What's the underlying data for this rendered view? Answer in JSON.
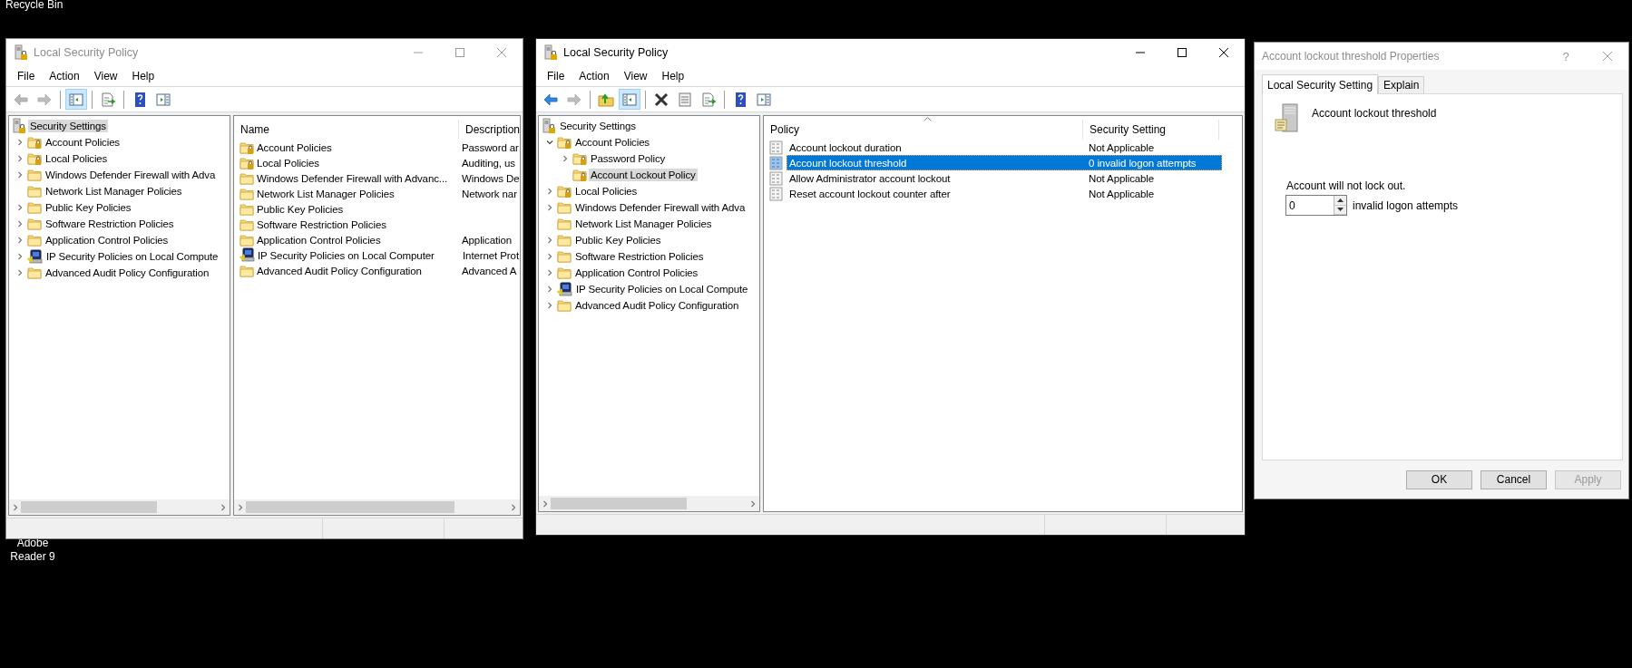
{
  "desktop": {
    "icons": [
      {
        "label": "Recycle Bin"
      },
      {
        "label": "Adobe Reader 9"
      }
    ]
  },
  "windows": [
    {
      "title": "Local Security Policy",
      "active": false,
      "menu": [
        "File",
        "Action",
        "View",
        "Help"
      ],
      "toolbar": [
        {
          "kind": "back",
          "enabled": false,
          "pressed": false
        },
        {
          "kind": "forward",
          "enabled": false,
          "pressed": false
        },
        {
          "kind": "separator"
        },
        {
          "kind": "tree-toggle",
          "enabled": true,
          "pressed": true
        },
        {
          "kind": "separator"
        },
        {
          "kind": "export",
          "enabled": true,
          "pressed": false
        },
        {
          "kind": "separator"
        },
        {
          "kind": "help",
          "enabled": true,
          "pressed": false
        },
        {
          "kind": "action-pane",
          "enabled": true,
          "pressed": false
        }
      ],
      "tree": [
        {
          "label": "Security Settings",
          "kind": "root",
          "selected": true,
          "children": [
            {
              "label": "Account Policies",
              "kind": "folder-lock",
              "expandable": true,
              "expanded": false,
              "selected": false
            },
            {
              "label": "Local Policies",
              "kind": "folder-lock",
              "expandable": true,
              "expanded": false,
              "selected": false
            },
            {
              "label": "Windows Defender Firewall with Adva",
              "kind": "folder",
              "expandable": true,
              "expanded": false,
              "selected": false
            },
            {
              "label": "Network List Manager Policies",
              "kind": "folder",
              "expandable": false,
              "expanded": false,
              "selected": false
            },
            {
              "label": "Public Key Policies",
              "kind": "folder",
              "expandable": true,
              "expanded": false,
              "selected": false
            },
            {
              "label": "Software Restriction Policies",
              "kind": "folder",
              "expandable": true,
              "expanded": false,
              "selected": false
            },
            {
              "label": "Application Control Policies",
              "kind": "folder",
              "expandable": true,
              "expanded": false,
              "selected": false
            },
            {
              "label": "IP Security Policies on Local Compute",
              "kind": "ipsec",
              "expandable": true,
              "expanded": false,
              "selected": false
            },
            {
              "label": "Advanced Audit Policy Configuration",
              "kind": "folder",
              "expandable": true,
              "expanded": false,
              "selected": false
            }
          ]
        }
      ],
      "list": {
        "columns": [
          {
            "label": "Name",
            "sorted": false
          },
          {
            "label": "Description",
            "sorted": false
          }
        ],
        "rows": [
          {
            "kind": "folder-lock",
            "cells": [
              "Account Policies",
              "Password ar"
            ],
            "selected": false
          },
          {
            "kind": "folder-lock",
            "cells": [
              "Local Policies",
              "Auditing, us"
            ],
            "selected": false
          },
          {
            "kind": "folder",
            "cells": [
              "Windows Defender Firewall with Advanc...",
              "Windows De"
            ],
            "selected": false
          },
          {
            "kind": "folder",
            "cells": [
              "Network List Manager Policies",
              "Network nar"
            ],
            "selected": false
          },
          {
            "kind": "folder",
            "cells": [
              "Public Key Policies"
            ],
            "selected": false
          },
          {
            "kind": "folder",
            "cells": [
              "Software Restriction Policies"
            ],
            "selected": false
          },
          {
            "kind": "folder",
            "cells": [
              "Application Control Policies",
              "Application"
            ],
            "selected": false
          },
          {
            "kind": "ipsec",
            "cells": [
              "IP Security Policies on Local Computer",
              "Internet Prot"
            ],
            "selected": false
          },
          {
            "kind": "folder",
            "cells": [
              "Advanced Audit Policy Configuration",
              "Advanced A"
            ],
            "selected": false
          }
        ]
      }
    },
    {
      "title": "Local Security Policy",
      "active": true,
      "menu": [
        "File",
        "Action",
        "View",
        "Help"
      ],
      "toolbar": [
        {
          "kind": "back",
          "enabled": true,
          "pressed": false
        },
        {
          "kind": "forward",
          "enabled": false,
          "pressed": false
        },
        {
          "kind": "separator"
        },
        {
          "kind": "up",
          "enabled": true,
          "pressed": false
        },
        {
          "kind": "tree-toggle",
          "enabled": true,
          "pressed": true
        },
        {
          "kind": "separator"
        },
        {
          "kind": "delete",
          "enabled": true,
          "pressed": false
        },
        {
          "kind": "properties",
          "enabled": true,
          "pressed": false
        },
        {
          "kind": "export",
          "enabled": true,
          "pressed": false
        },
        {
          "kind": "separator"
        },
        {
          "kind": "help",
          "enabled": true,
          "pressed": false
        },
        {
          "kind": "action-pane",
          "enabled": true,
          "pressed": false
        }
      ],
      "tree": [
        {
          "label": "Security Settings",
          "kind": "root",
          "selected": false,
          "children": [
            {
              "label": "Account Policies",
              "kind": "folder-lock",
              "expandable": true,
              "expanded": true,
              "selected": false,
              "children": [
                {
                  "label": "Password Policy",
                  "kind": "folder-lock",
                  "expandable": true,
                  "expanded": false,
                  "selected": false
                },
                {
                  "label": "Account Lockout Policy",
                  "kind": "folder-lock",
                  "expandable": false,
                  "expanded": false,
                  "selected": true
                }
              ]
            },
            {
              "label": "Local Policies",
              "kind": "folder-lock",
              "expandable": true,
              "expanded": false,
              "selected": false
            },
            {
              "label": "Windows Defender Firewall with Adva",
              "kind": "folder",
              "expandable": true,
              "expanded": false,
              "selected": false
            },
            {
              "label": "Network List Manager Policies",
              "kind": "folder",
              "expandable": false,
              "expanded": false,
              "selected": false
            },
            {
              "label": "Public Key Policies",
              "kind": "folder",
              "expandable": true,
              "expanded": false,
              "selected": false
            },
            {
              "label": "Software Restriction Policies",
              "kind": "folder",
              "expandable": true,
              "expanded": false,
              "selected": false
            },
            {
              "label": "Application Control Policies",
              "kind": "folder",
              "expandable": true,
              "expanded": false,
              "selected": false
            },
            {
              "label": "IP Security Policies on Local Compute",
              "kind": "ipsec",
              "expandable": true,
              "expanded": false,
              "selected": false
            },
            {
              "label": "Advanced Audit Policy Configuration",
              "kind": "folder",
              "expandable": true,
              "expanded": false,
              "selected": false
            }
          ]
        }
      ],
      "list": {
        "columns": [
          {
            "label": "Policy",
            "sorted": true
          },
          {
            "label": "Security Setting",
            "sorted": false
          }
        ],
        "rows": [
          {
            "kind": "policy",
            "cells": [
              "Account lockout duration",
              "Not Applicable"
            ],
            "selected": false
          },
          {
            "kind": "policy",
            "cells": [
              "Account lockout threshold",
              "0 invalid logon attempts"
            ],
            "selected": true
          },
          {
            "kind": "policy",
            "cells": [
              "Allow Administrator account lockout",
              "Not Applicable"
            ],
            "selected": false
          },
          {
            "kind": "policy",
            "cells": [
              "Reset account lockout counter after",
              "Not Applicable"
            ],
            "selected": false
          }
        ]
      }
    }
  ],
  "dialog": {
    "title": "Account lockout threshold Properties",
    "active": false,
    "help": "?",
    "tabs": [
      {
        "label": "Local Security Setting",
        "selected": true
      },
      {
        "label": "Explain",
        "selected": false
      }
    ],
    "policy_name": "Account lockout threshold",
    "message": "Account will not lock out.",
    "spin": {
      "value": "0",
      "unit": "invalid logon attempts"
    },
    "buttons": [
      {
        "label": "OK",
        "disabled": false
      },
      {
        "label": "Cancel",
        "disabled": false
      },
      {
        "label": "Apply",
        "disabled": true
      }
    ]
  }
}
